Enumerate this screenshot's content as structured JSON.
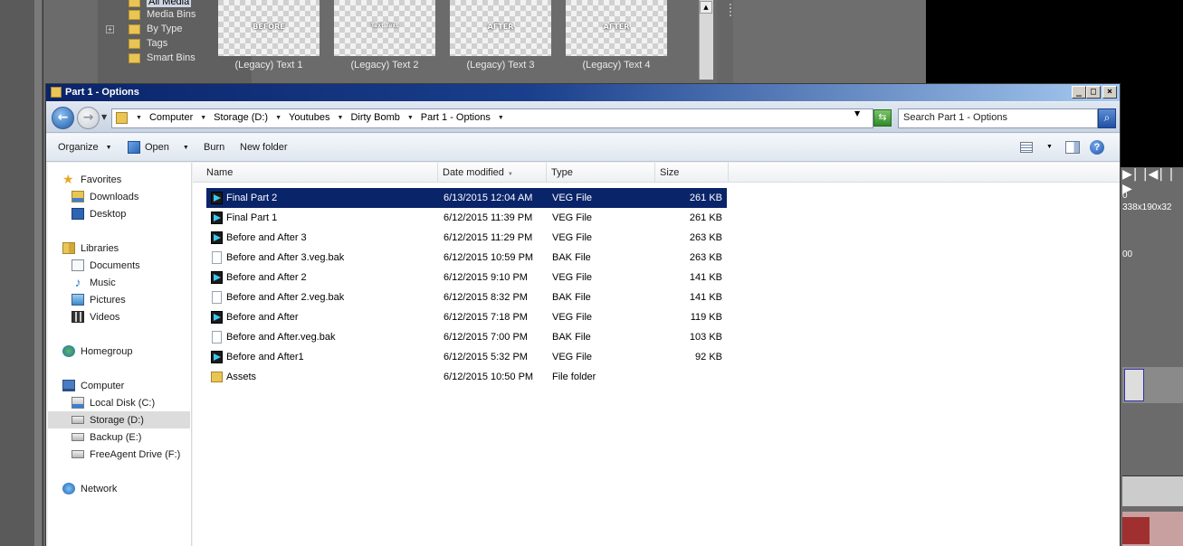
{
  "background": {
    "tree_items": [
      {
        "label": "All Media",
        "expand": false
      },
      {
        "label": "Media Bins",
        "expand": false
      },
      {
        "label": "By Type",
        "expand": true
      },
      {
        "label": "Tags",
        "expand": false
      },
      {
        "label": "Smart Bins",
        "expand": false
      }
    ],
    "thumbnails": [
      {
        "overlay": "BEFORE",
        "label": "(Legacy) Text 1"
      },
      {
        "overlay": "Text Text",
        "label": "(Legacy) Text 2"
      },
      {
        "overlay": "AFTER",
        "label": "(Legacy) Text 3"
      },
      {
        "overlay": "AFTER",
        "label": "(Legacy) Text 4"
      }
    ],
    "transport_glyphs": "▶| |◀| |▶",
    "time_readout": "0",
    "resolution": "338x190x32",
    "timecode": "00"
  },
  "window": {
    "title": "Part 1 - Options",
    "minimize": "_",
    "maximize": "□",
    "close": "×"
  },
  "address": {
    "crumbs": [
      "Computer",
      "Storage (D:)",
      "Youtubes",
      "Dirty Bomb",
      "Part 1 - Options"
    ],
    "search_placeholder": "Search Part 1 - Options"
  },
  "toolbar": {
    "organize": "Organize",
    "open": "Open",
    "burn": "Burn",
    "new_folder": "New folder",
    "help": "?"
  },
  "nav": {
    "items": [
      {
        "label": "Favorites",
        "icon": "star-icon",
        "group": true
      },
      {
        "label": "Downloads",
        "icon": "downloads-folder-icon",
        "group": false
      },
      {
        "label": "Desktop",
        "icon": "desktop-icon",
        "group": false
      },
      {
        "label": "Libraries",
        "icon": "libraries-icon",
        "group": true
      },
      {
        "label": "Documents",
        "icon": "documents-icon",
        "group": false
      },
      {
        "label": "Music",
        "icon": "music-icon",
        "group": false
      },
      {
        "label": "Pictures",
        "icon": "pictures-icon",
        "group": false
      },
      {
        "label": "Videos",
        "icon": "videos-icon",
        "group": false
      },
      {
        "label": "Homegroup",
        "icon": "homegroup-icon",
        "group": true
      },
      {
        "label": "Computer",
        "icon": "computer-icon",
        "group": true
      },
      {
        "label": "Local Disk (C:)",
        "icon": "local-disk-icon",
        "group": false
      },
      {
        "label": "Storage (D:)",
        "icon": "drive-icon",
        "group": false,
        "selected": true
      },
      {
        "label": "Backup (E:)",
        "icon": "drive-icon",
        "group": false
      },
      {
        "label": "FreeAgent Drive (F:)",
        "icon": "drive-icon",
        "group": false
      },
      {
        "label": "Network",
        "icon": "network-icon",
        "group": true
      }
    ]
  },
  "columns": {
    "name": "Name",
    "date": "Date modified",
    "type": "Type",
    "size": "Size"
  },
  "files": [
    {
      "name": "Final Part 2",
      "date": "6/13/2015 12:04 AM",
      "type": "VEG File",
      "size": "261 KB",
      "icon": "veg",
      "selected": true
    },
    {
      "name": "Final Part 1",
      "date": "6/12/2015 11:39 PM",
      "type": "VEG File",
      "size": "261 KB",
      "icon": "veg"
    },
    {
      "name": "Before and After 3",
      "date": "6/12/2015 11:29 PM",
      "type": "VEG File",
      "size": "263 KB",
      "icon": "veg"
    },
    {
      "name": "Before and After 3.veg.bak",
      "date": "6/12/2015 10:59 PM",
      "type": "BAK File",
      "size": "263 KB",
      "icon": "bak"
    },
    {
      "name": "Before and After 2",
      "date": "6/12/2015 9:10 PM",
      "type": "VEG File",
      "size": "141 KB",
      "icon": "veg"
    },
    {
      "name": "Before and After 2.veg.bak",
      "date": "6/12/2015 8:32 PM",
      "type": "BAK File",
      "size": "141 KB",
      "icon": "bak"
    },
    {
      "name": "Before and After",
      "date": "6/12/2015 7:18 PM",
      "type": "VEG File",
      "size": "119 KB",
      "icon": "veg"
    },
    {
      "name": "Before and After.veg.bak",
      "date": "6/12/2015 7:00 PM",
      "type": "BAK File",
      "size": "103 KB",
      "icon": "bak"
    },
    {
      "name": "Before and After1",
      "date": "6/12/2015 5:32 PM",
      "type": "VEG File",
      "size": "92 KB",
      "icon": "veg"
    },
    {
      "name": "Assets",
      "date": "6/12/2015 10:50 PM",
      "type": "File folder",
      "size": "",
      "icon": "folder"
    }
  ]
}
